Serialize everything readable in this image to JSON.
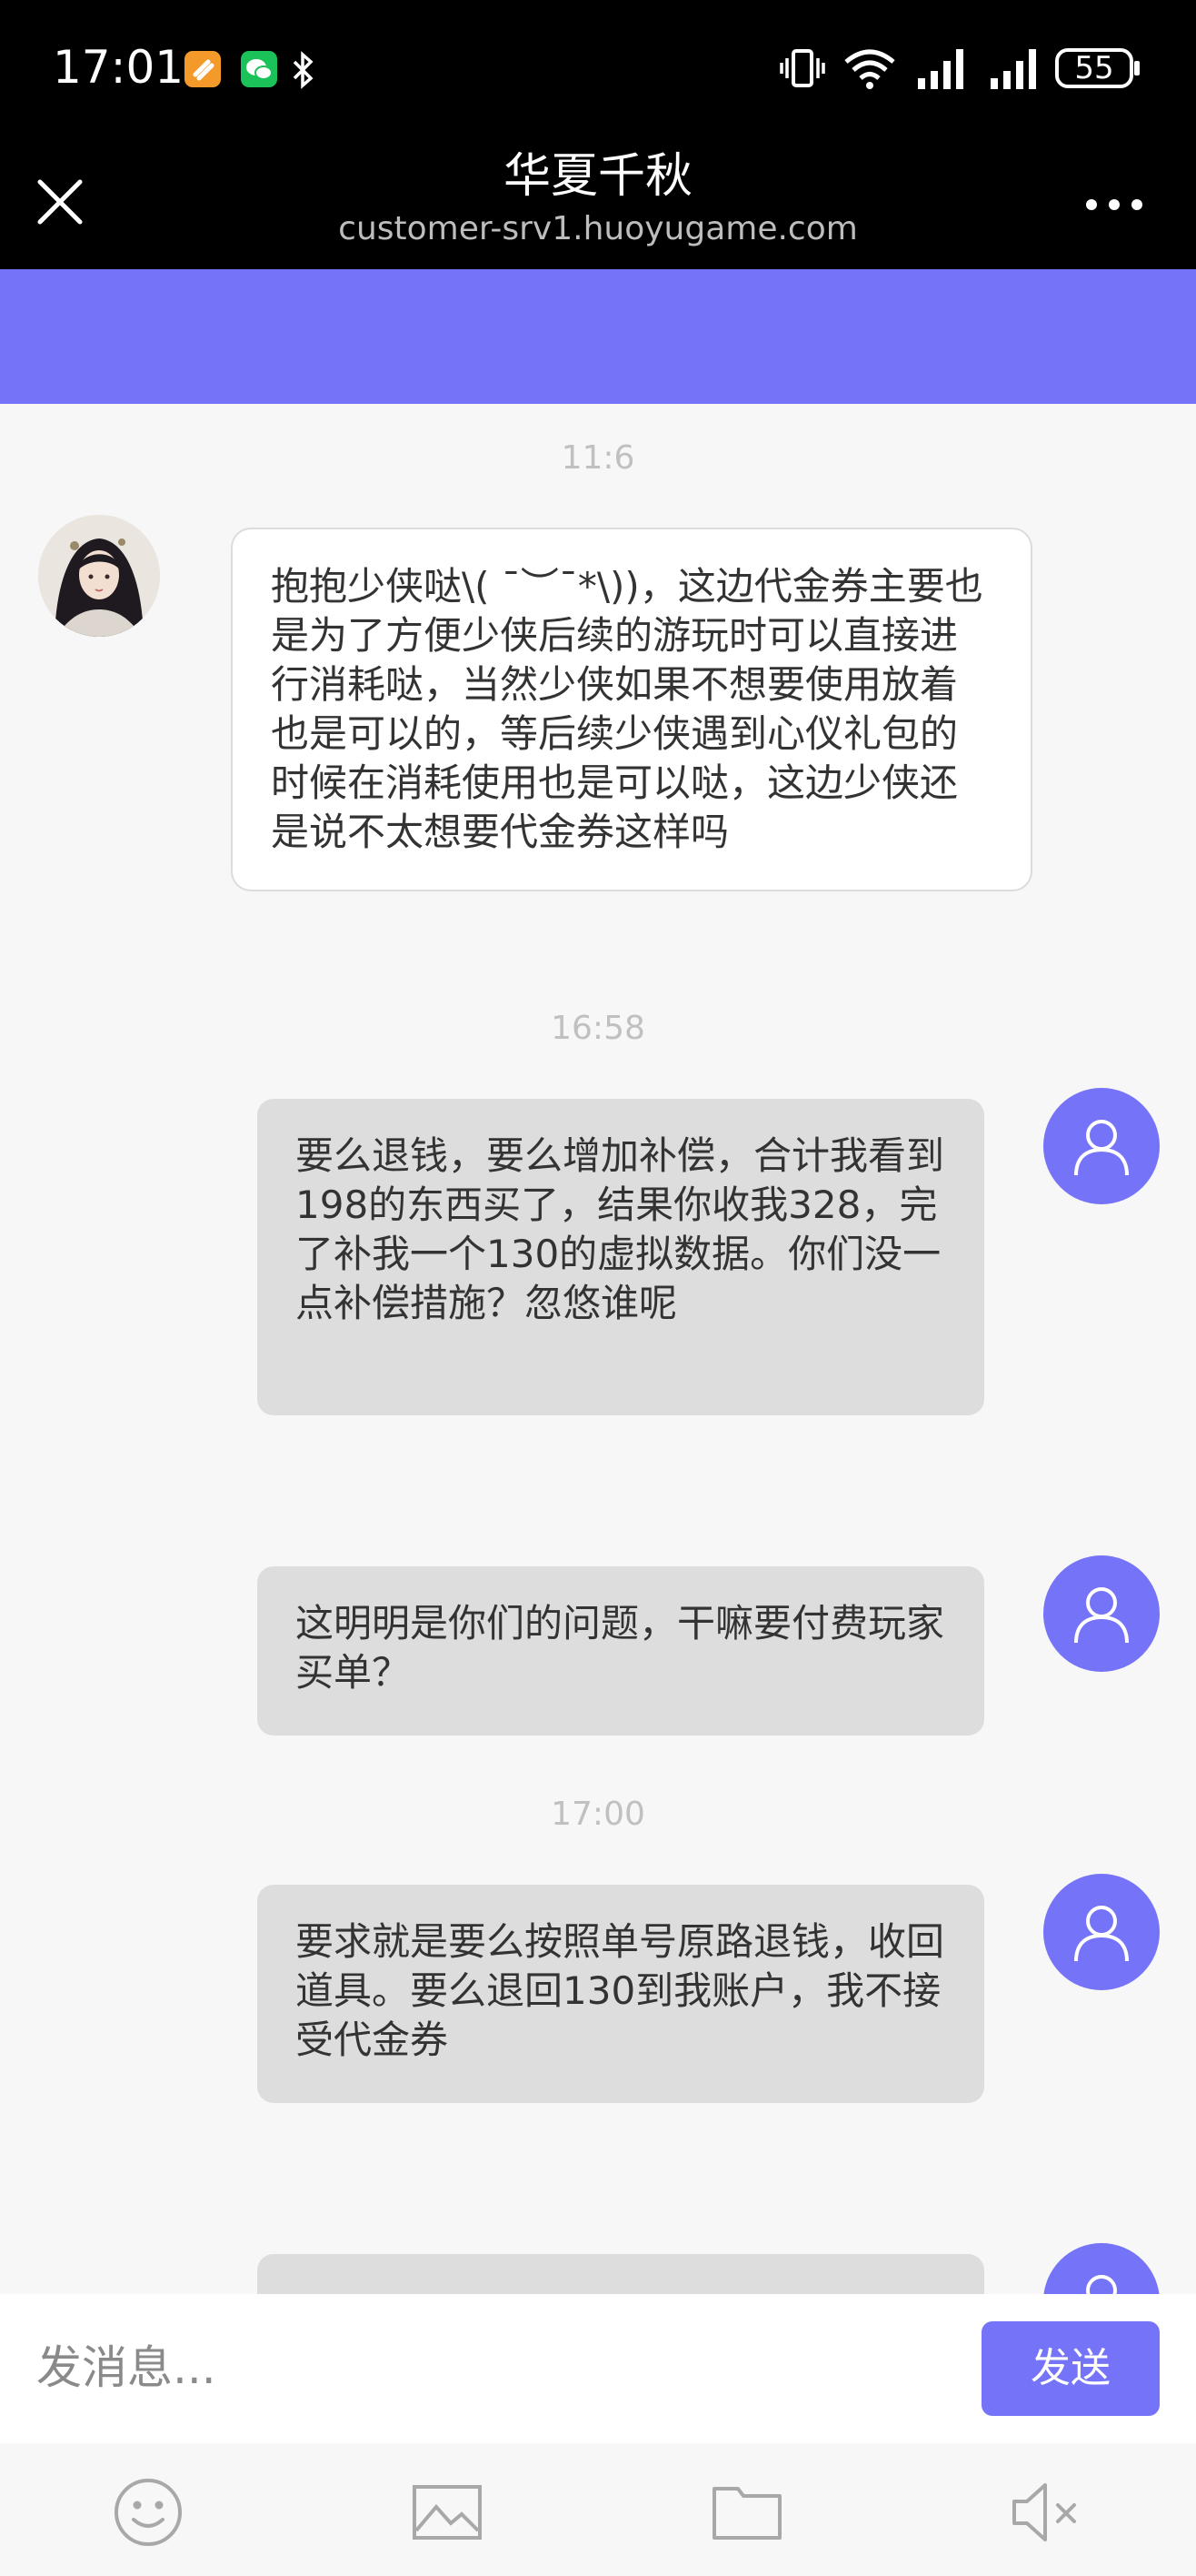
{
  "status_bar": {
    "time": "17:01",
    "battery": "55",
    "icons": [
      "orange-app-icon",
      "wechat-icon",
      "bluetooth-icon",
      "vibrate-icon",
      "wifi-icon",
      "signal-icon",
      "signal-icon",
      "battery-icon"
    ]
  },
  "header": {
    "title": "华夏千秋",
    "url": "customer-srv1.huoyugame.com",
    "close_icon": "close-icon",
    "more_icon": "more-icon"
  },
  "colors": {
    "accent": "#7573f7",
    "user_bubble": "#dddddd",
    "agent_bubble": "#ffffff",
    "background": "#f7f7f7"
  },
  "messages": [
    {
      "timestamp": "11:6"
    },
    {
      "sender": "agent",
      "text": "抱抱少侠哒\\( ¯︶¯*\\))，这边代金券主要也是为了方便少侠后续的游玩时可以直接进行消耗哒，当然少侠如果不想要使用放着也是可以的，等后续少侠遇到心仪礼包的时候在消耗使用也是可以哒，这边少侠还是说不太想要代金券这样吗"
    },
    {
      "timestamp": "16:58"
    },
    {
      "sender": "user",
      "text": "要么退钱，要么增加补偿，合计我看到198的东西买了，结果你收我328，完了补我一个130的虚拟数据。你们没一点补偿措施？忽悠谁呢"
    },
    {
      "sender": "user",
      "text": "这明明是你们的问题，干嘛要付费玩家买单？"
    },
    {
      "timestamp": "17:00"
    },
    {
      "sender": "user",
      "text": "要求就是要么按照单号原路退钱，收回道具。要么退回130到我账户，我不接受代金券"
    }
  ],
  "input": {
    "placeholder": "发消息...",
    "value": "",
    "send_label": "发送"
  },
  "toolbar": {
    "icons": [
      "emoji-icon",
      "image-icon",
      "folder-icon",
      "speaker-mute-icon"
    ]
  }
}
